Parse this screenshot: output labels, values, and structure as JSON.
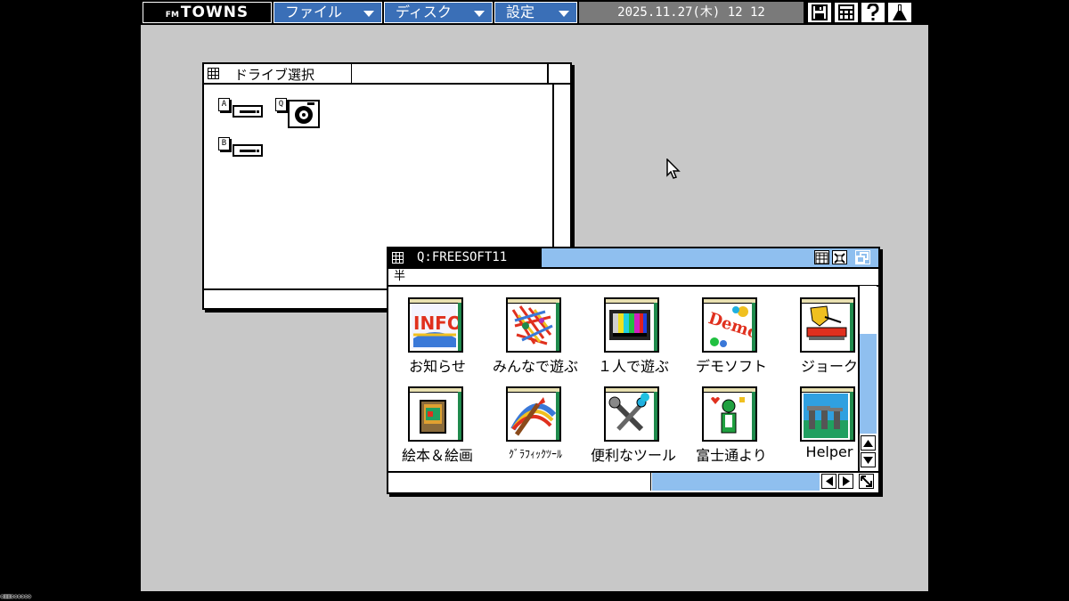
{
  "menubar": {
    "logo_prefix": "FM",
    "logo": "TOWNS",
    "menus": [
      {
        "label": "ファイル"
      },
      {
        "label": "ディスク"
      },
      {
        "label": "設定"
      }
    ],
    "clock": "2025.11.27(木) 12 12",
    "system_icons": [
      "floppy-save-icon",
      "window-tile-icon",
      "help-icon",
      "flask-icon"
    ]
  },
  "drive_window": {
    "title": "ドライブ選択",
    "drives": [
      {
        "letter": "A",
        "type": "floppy"
      },
      {
        "letter": "Q",
        "type": "cdrom"
      },
      {
        "letter": "B",
        "type": "floppy"
      }
    ]
  },
  "file_window": {
    "title": "Q:FREESOFT11",
    "path": "半",
    "icons": [
      {
        "label": "お知らせ",
        "icon": "info-icon"
      },
      {
        "label": "みんなで遊ぶ",
        "icon": "party-icon"
      },
      {
        "label": "１人で遊ぶ",
        "icon": "tv-colorbars-icon"
      },
      {
        "label": "デモソフト",
        "icon": "demo-icon"
      },
      {
        "label": "ジョーク",
        "icon": "joke-icon"
      },
      {
        "label": "絵本＆絵画",
        "icon": "picture-book-icon"
      },
      {
        "label": "ｸﾞﾗﾌｨｯｸﾂｰﾙ",
        "icon": "paint-brush-icon"
      },
      {
        "label": "便利なツール",
        "icon": "wrench-tools-icon"
      },
      {
        "label": "富士通より",
        "icon": "fujitsu-person-icon"
      },
      {
        "label": "Helper",
        "icon": "stonehenge-icon"
      }
    ]
  },
  "colors": {
    "desktop": "#c8c8c8",
    "menu_blue": "#3a6fb7",
    "title_active": "#8fbfef",
    "scroll_blue": "#8fbfef"
  },
  "statusline": "◎▥▥◎◎◎◎◎◎"
}
